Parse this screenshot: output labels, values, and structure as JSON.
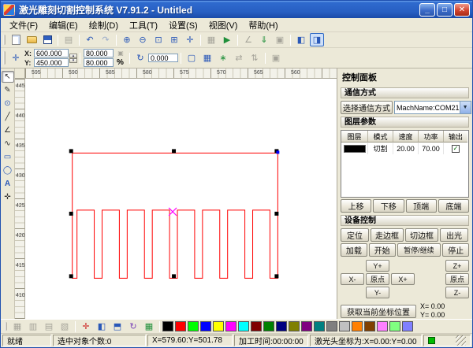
{
  "window": {
    "title": "激光雕刻切割控制系统 V7.91.2 - Untitled",
    "controls": {
      "min": "_",
      "max": "□",
      "close": "✕"
    }
  },
  "menu": {
    "items": [
      "文件(F)",
      "编辑(E)",
      "绘制(D)",
      "工具(T)",
      "设置(S)",
      "视图(V)",
      "帮助(H)"
    ]
  },
  "toolbar": {
    "x_label": "X:",
    "y_label": "Y:",
    "x_value": "600.000",
    "y_value": "450.000",
    "w_value": "80.000",
    "h_value": "80.000",
    "percent_label": "%",
    "rotate_value": "0.000"
  },
  "rulers": {
    "top": [
      "595",
      "590",
      "585",
      "580",
      "575",
      "570",
      "565",
      "560"
    ],
    "left": [
      "445",
      "440",
      "435",
      "430",
      "425",
      "420",
      "415",
      "410"
    ]
  },
  "panel": {
    "title": "控制面板",
    "comm_group": "通信方式",
    "comm_button": "选择通信方式",
    "comm_combo": "MachName:COM21",
    "layer_group": "图层参数",
    "layer_headers": [
      "图层",
      "模式",
      "速度",
      "功率",
      "输出"
    ],
    "layer_row": {
      "color": "#000000",
      "mode": "切割",
      "speed": "20.00",
      "power": "70.00",
      "output_mark": "✓"
    },
    "layer_buttons": [
      "上移",
      "下移",
      "顶端",
      "底端"
    ],
    "device_group": "设备控制",
    "device_row1": [
      "定位",
      "走边框",
      "切边框",
      "出光"
    ],
    "device_row2": [
      "加载",
      "开始",
      "暂停/继续",
      "停止"
    ],
    "jog": {
      "y_plus": "Y+",
      "x_minus": "X-",
      "origin_xy": "原点",
      "x_plus": "X+",
      "y_minus": "Y-",
      "z_plus": "Z+",
      "origin_z": "原点",
      "z_minus": "Z-"
    },
    "get_pos_button": "获取当前坐标位置",
    "pos_x": "X= 0.00",
    "pos_y": "Y= 0.00"
  },
  "statusbar": {
    "ready": "就绪",
    "selected": "选中对象个数:0",
    "mouse": "X=579.60:Y=501.78",
    "time": "加工时间:00:00:00",
    "laser": "激光头坐标为:X=0.00:Y=0.00"
  },
  "palette": {
    "colors": [
      "#000000",
      "#FF0000",
      "#00FF00",
      "#0000FF",
      "#FFFF00",
      "#FF00FF",
      "#00FFFF",
      "#800000",
      "#008000",
      "#000080",
      "#808000",
      "#800080",
      "#008080",
      "#808080",
      "#C0C0C0",
      "#FF8000",
      "#804000",
      "#FF80FF",
      "#80FF80",
      "#8080FF"
    ]
  },
  "colors": {
    "shape": "#FF0000",
    "handle": "#000000",
    "center_mark": "#FF00FF",
    "node": "#0000FF",
    "led": "#00BB00"
  }
}
